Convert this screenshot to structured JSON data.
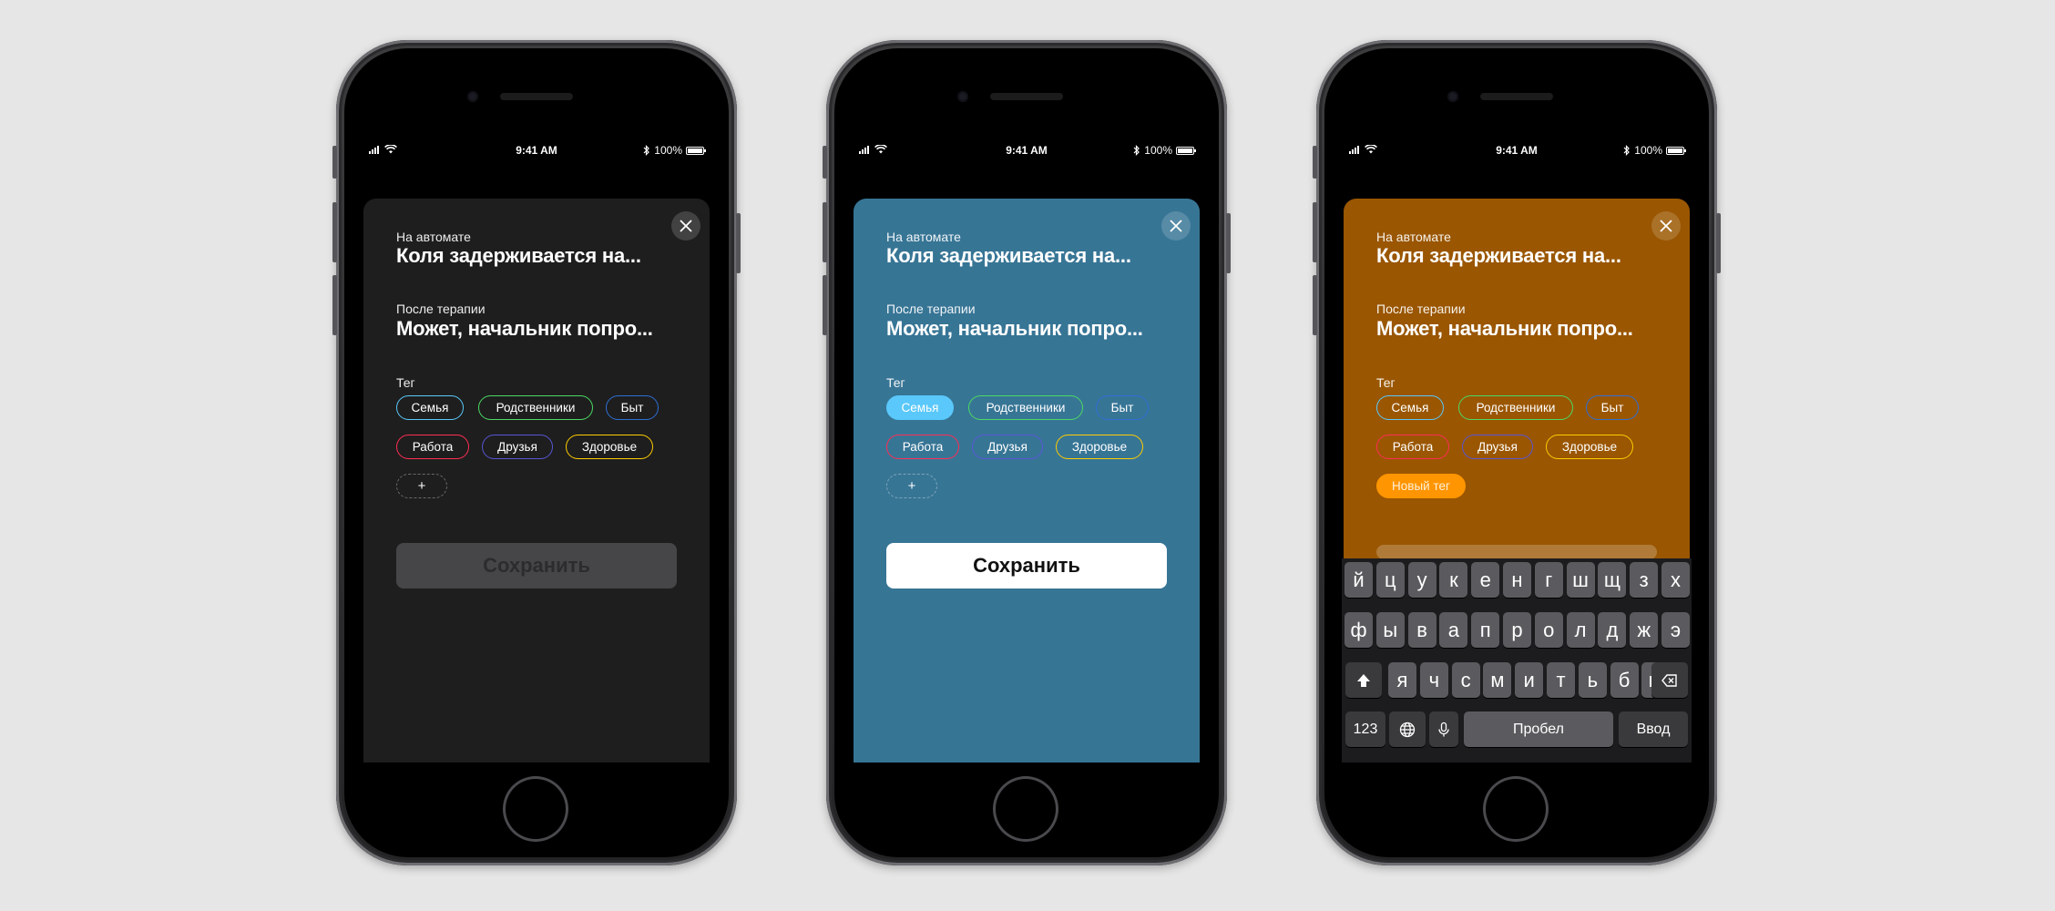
{
  "status": {
    "time": "9:41 AM",
    "battery": "100%"
  },
  "screens": [
    {
      "bg": "#1e1e1e",
      "auto_label": "На автомате",
      "auto_text": "Коля задерживается на...",
      "after_label": "После терапии",
      "after_text": "Может, начальник попро...",
      "tag_label": "Тег",
      "tags": [
        "Семья",
        "Родственники",
        "Быт",
        "Работа",
        "Друзья",
        "Здоровье",
        "+"
      ],
      "save_label": "Сохранить",
      "save_state": "disabled"
    },
    {
      "bg": "#377595",
      "auto_label": "На автомате",
      "auto_text": "Коля задерживается на...",
      "after_label": "После терапии",
      "after_text": "Может, начальник попро...",
      "tag_label": "Тег",
      "tags": [
        "Семья",
        "Родственники",
        "Быт",
        "Работа",
        "Друзья",
        "Здоровье",
        "+"
      ],
      "selected_tag": "Семья",
      "save_label": "Сохранить",
      "save_state": "enabled"
    },
    {
      "bg": "#9a5601",
      "auto_label": "На автомате",
      "auto_text": "Коля задерживается на...",
      "after_label": "После терапии",
      "after_text": "Может, начальник попро...",
      "tag_label": "Тег",
      "tags": [
        "Семья",
        "Родственники",
        "Быт",
        "Работа",
        "Друзья",
        "Здоровье"
      ],
      "new_tag_placeholder": "Новый тег"
    }
  ],
  "tag_colors": {
    "Семья": "#5ac8fa",
    "Родственники": "#4cd964",
    "Быт": "#2f6fd6",
    "Работа": "#ff2d55",
    "Друзья": "#5856d6",
    "Здоровье": "#ffcc00"
  },
  "keyboard": {
    "row1": [
      "й",
      "ц",
      "у",
      "к",
      "е",
      "н",
      "г",
      "ш",
      "щ",
      "з",
      "х"
    ],
    "row2": [
      "ф",
      "ы",
      "в",
      "а",
      "п",
      "р",
      "о",
      "л",
      "д",
      "ж",
      "э"
    ],
    "row3": [
      "я",
      "ч",
      "с",
      "м",
      "и",
      "т",
      "ь",
      "б",
      "ю"
    ],
    "numbers_key": "123",
    "space_key": "Пробел",
    "return_key": "Ввод",
    "shift_icon": "shift-icon",
    "delete_icon": "delete-icon",
    "globe_icon": "globe-icon",
    "mic_icon": "microphone-icon"
  }
}
